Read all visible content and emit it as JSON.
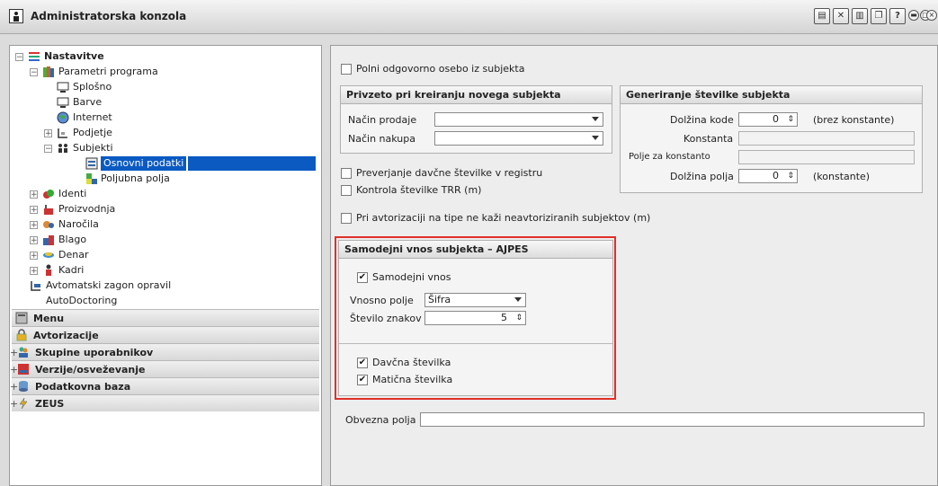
{
  "window": {
    "title": "Administratorska konzola"
  },
  "toolbar": {
    "buttons": [
      "doc-icon",
      "tools-icon",
      "print-icon",
      "copy-icon",
      "help-icon"
    ],
    "help_label": "?"
  },
  "sidebar": {
    "root": "Nastavitve",
    "parametri": "Parametri programa",
    "splosno": "Splošno",
    "barve": "Barve",
    "internet": "Internet",
    "podjetje": "Podjetje",
    "subjekti": "Subjekti",
    "osnovni": "Osnovni podatki",
    "poljubna": "Poljubna polja",
    "identi": "Identi",
    "proizvodnja": "Proizvodnja",
    "narocila": "Naročila",
    "blago": "Blago",
    "denar": "Denar",
    "kadri": "Kadri",
    "avtomatski": "Avtomatski zagon opravil",
    "autodoctoring": "AutoDoctoring",
    "menu": "Menu",
    "avtorizacije": "Avtorizacije",
    "skupine": "Skupine uporabnikov",
    "verzije": "Verzije/osveževanje",
    "podatkovna": "Podatkovna baza",
    "zeus": "ZEUS",
    "toggle_minus": "−",
    "toggle_plus": "+"
  },
  "main": {
    "polni": "Polni odgovorno osebo iz subjekta",
    "prevzeto_head": "Privzeto pri kreiranju novega subjekta",
    "nacin_prodaje": "Način prodaje",
    "nacin_nakupa": "Način nakupa",
    "gen_head": "Generiranje številke subjekta",
    "dolzina_kode": "Dolžina kode",
    "dolzina_kode_val": "0",
    "brez_konst": "(brez konstante)",
    "konstanta": "Konstanta",
    "polje_za_konst": "Polje za konstanto",
    "dolzina_polja": "Dolžina polja",
    "dolzina_polja_val": "0",
    "konstante": "(konstante)",
    "preverjanje": "Preverjanje davčne številke v registru",
    "kontrola": "Kontrola številke TRR (m)",
    "pri_avtorizaciji": "Pri avtorizaciji na tipe ne kaži neavtoriziranih subjektov (m)",
    "samodejni_head": "Samodejni vnos subjekta – AJPES",
    "samodejni_vnos": "Samodejni vnos",
    "vnosno_polje": "Vnosno polje",
    "vnosno_polje_val": "Šifra",
    "stevilo_znakov": "Število znakov",
    "stevilo_znakov_val": "5",
    "davcna": "Davčna številka",
    "maticna": "Matična številka",
    "obvezna": "Obvezna polja",
    "check": "✔",
    "spin": "⇕"
  },
  "colors": {
    "selection": "#0a5ac2",
    "highlight": "#e0302a"
  }
}
